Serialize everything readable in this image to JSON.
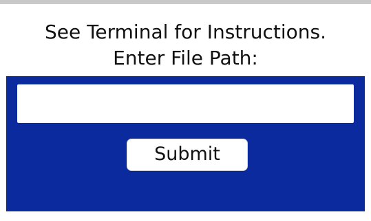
{
  "prompt": {
    "line1": "See Terminal for Instructions.",
    "line2": "Enter File Path:"
  },
  "path_input": {
    "value": "",
    "placeholder": ""
  },
  "submit_label": "Submit",
  "colors": {
    "panel": "#0a2a9e",
    "background": "#ffffff",
    "top_edge": "#c9c9c9"
  }
}
